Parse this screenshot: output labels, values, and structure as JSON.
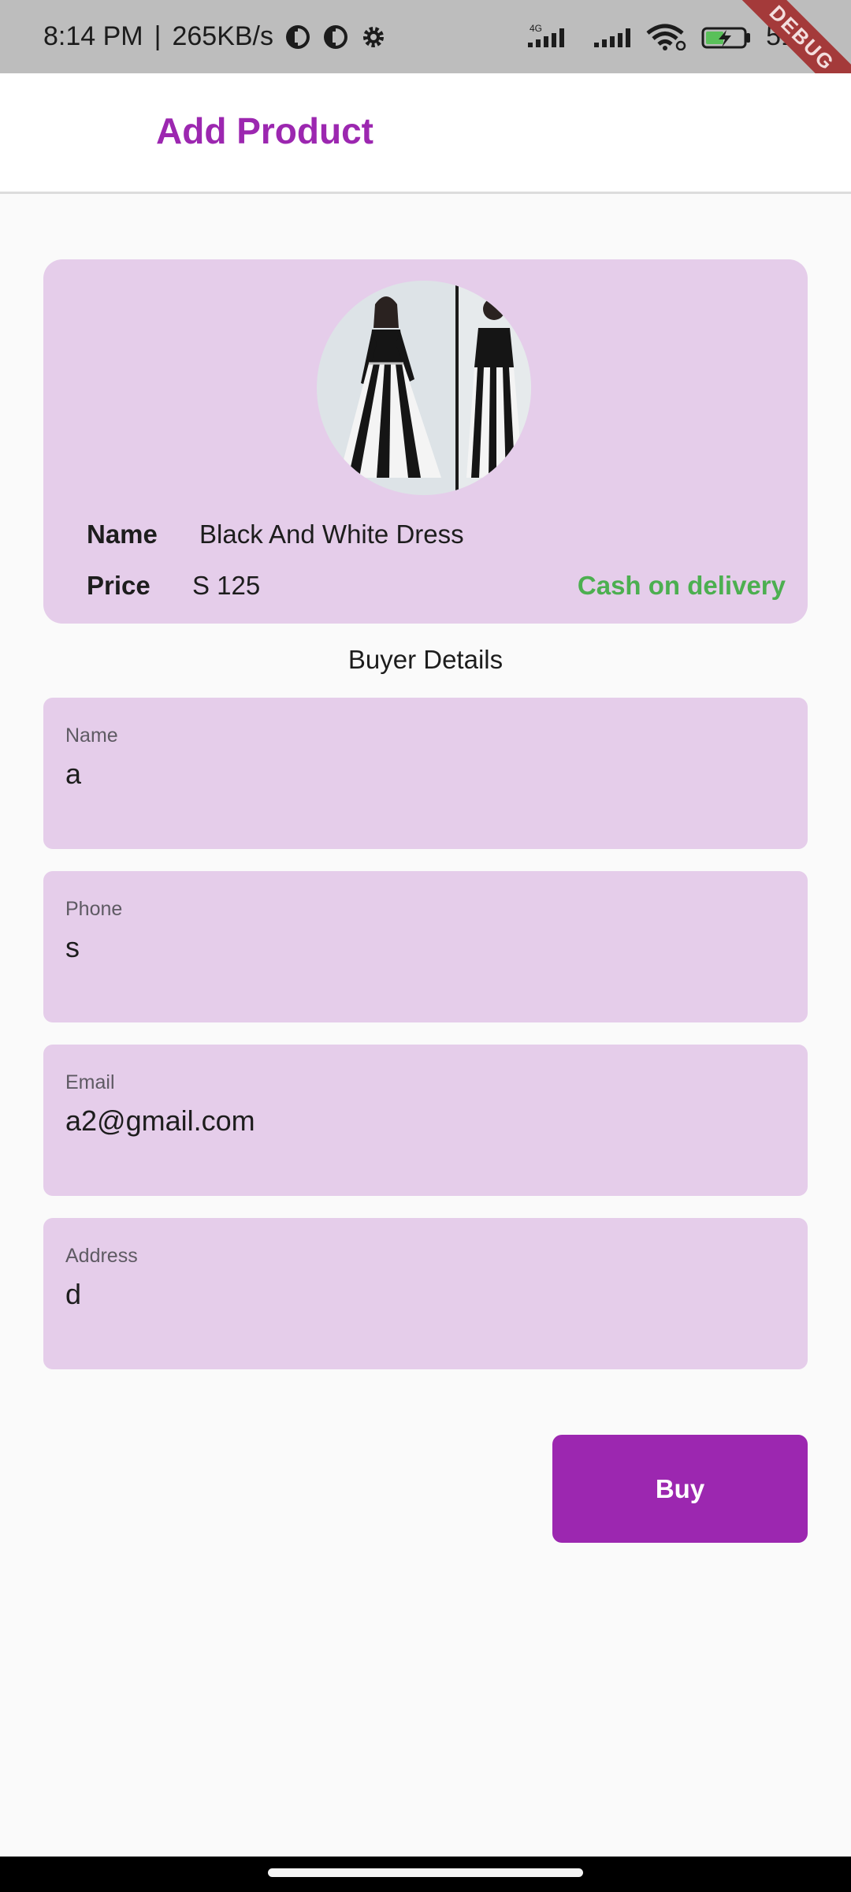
{
  "status_bar": {
    "time": "8:14 PM",
    "separator": "|",
    "speed": "265KB/s",
    "network": "4G",
    "battery": "51",
    "debug_banner": "DEBUG"
  },
  "app_bar": {
    "title": "Add Product"
  },
  "product": {
    "name_label": "Name",
    "name": "Black And White Dress",
    "price_label": "Price",
    "price": "S 125",
    "payment": "Cash on delivery"
  },
  "buyer": {
    "section_title": "Buyer Details",
    "fields": [
      {
        "label": "Name",
        "value": "a"
      },
      {
        "label": "Phone",
        "value": "s"
      },
      {
        "label": "Email",
        "value": "a2@gmail.com"
      },
      {
        "label": "Address",
        "value": "d"
      }
    ]
  },
  "actions": {
    "buy_label": "Buy"
  },
  "colors": {
    "accent": "#9c27b0",
    "card": "#e5cdea",
    "payment": "#4caf50",
    "debug": "#a43a3a"
  }
}
